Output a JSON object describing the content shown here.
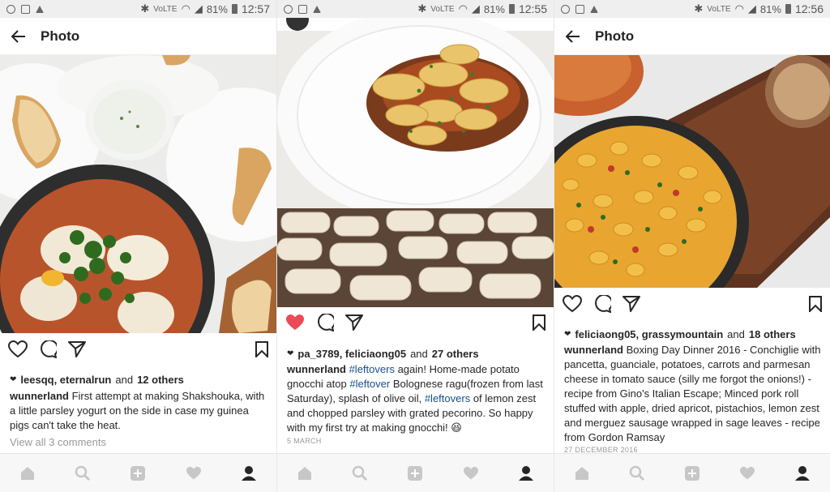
{
  "screens": [
    {
      "status": {
        "battery": "81%",
        "time": "12:57"
      },
      "appbar": {
        "title": "Photo"
      },
      "likes": {
        "users": "leesqq, eternalrun",
        "and": "and",
        "others": "12 others"
      },
      "caption": {
        "user": "wunnerland",
        "text": "First attempt at making Shakshouka, with a little parsley yogurt on the side in case my guinea pigs can't take the heat."
      },
      "view_all": "View all 3 comments"
    },
    {
      "status": {
        "battery": "81%",
        "time": "12:55"
      },
      "likes": {
        "users": "pa_3789, feliciaong05",
        "and": "and",
        "others": "27 others"
      },
      "caption": {
        "user": "wunnerland",
        "tag1": "#leftovers",
        "t1": "again! Home-made potato gnocchi atop",
        "tag2": "#leftover",
        "t2": "Bolognese ragu(frozen from last Saturday), splash of olive oil,",
        "tag3": "#leftovers",
        "t3": "of lemon zest and chopped parsley with grated pecorino. So happy with my first try at making gnocchi! 😆"
      },
      "date": "5 MARCH"
    },
    {
      "status": {
        "battery": "81%",
        "time": "12:56"
      },
      "appbar": {
        "title": "Photo"
      },
      "likes": {
        "users": "feliciaong05, grassymountain",
        "and": "and",
        "others": "18 others"
      },
      "caption": {
        "user": "wunnerland",
        "text": "Boxing Day Dinner 2016 - Conchiglie with pancetta, guanciale, potatoes, carrots and parmesan cheese in tomato sauce (silly me forgot the onions!) - recipe from Gino's Italian Escape; Minced pork roll stuffed with apple, dried apricot, pistachios, lemon zest and merguez sausage wrapped in sage leaves - recipe from Gordon Ramsay"
      },
      "date": "27 DECEMBER 2016"
    }
  ],
  "status_icons": [
    "whatsapp-icon",
    "image-icon",
    "upload-icon",
    "bluetooth-icon",
    "volte-icon",
    "wifi-icon",
    "signal-icon",
    "battery-icon"
  ],
  "status_labels": {
    "volte": "VoLTE"
  },
  "colors": {
    "like_active": "#ed4956",
    "hashtag": "#1a4e8a",
    "icon": "#262626",
    "nav_inactive": "#c7c7c7"
  }
}
